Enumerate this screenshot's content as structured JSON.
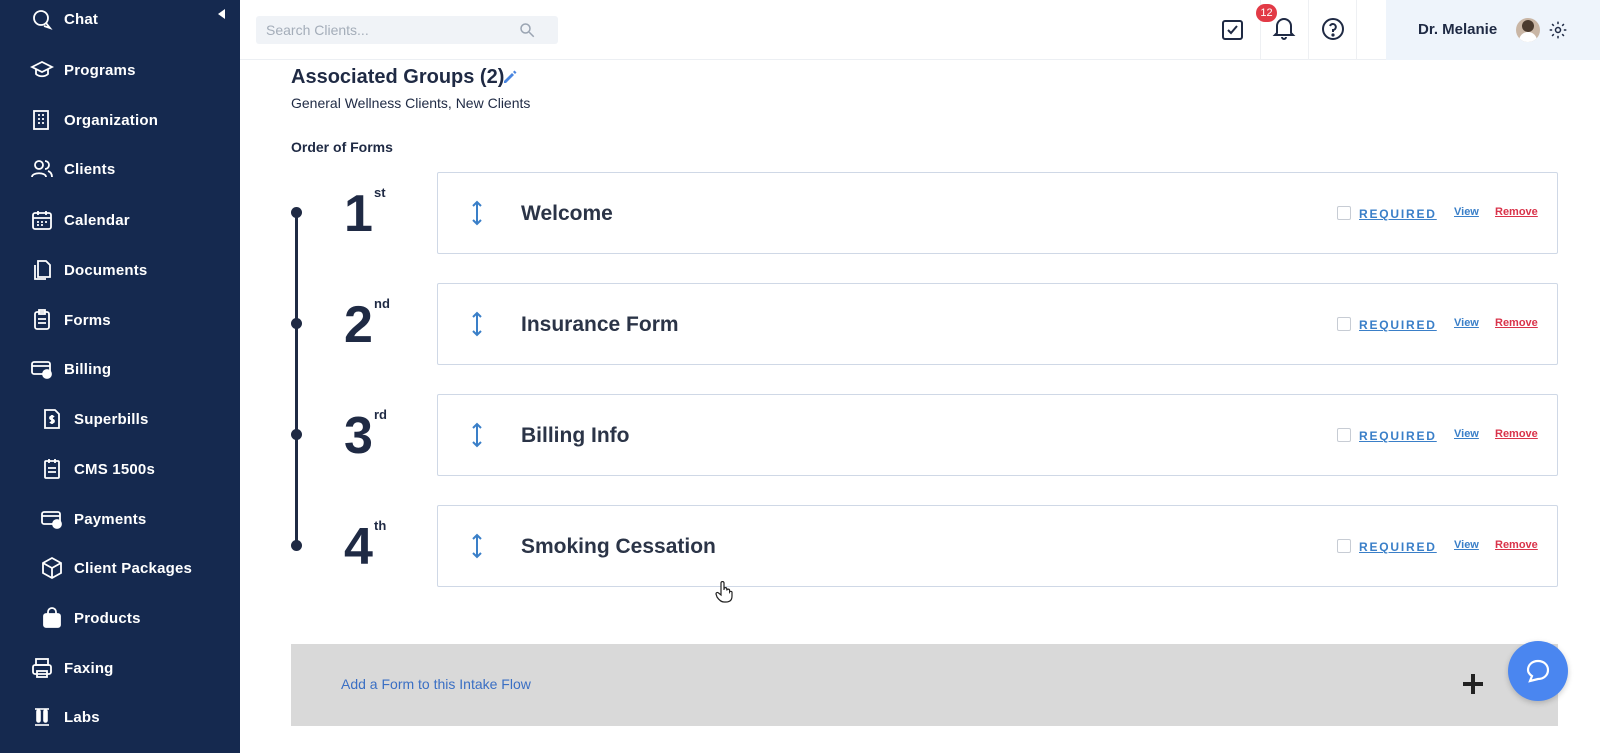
{
  "sidebar": {
    "items": [
      {
        "label": "Chat",
        "icon": "chat-icon"
      },
      {
        "label": "Programs",
        "icon": "graduation-cap-icon"
      },
      {
        "label": "Organization",
        "icon": "building-icon"
      },
      {
        "label": "Clients",
        "icon": "users-icon"
      },
      {
        "label": "Calendar",
        "icon": "calendar-icon"
      },
      {
        "label": "Documents",
        "icon": "documents-icon"
      },
      {
        "label": "Forms",
        "icon": "clipboard-icon"
      },
      {
        "label": "Billing",
        "icon": "billing-icon"
      },
      {
        "label": "Superbills",
        "icon": "superbill-icon"
      },
      {
        "label": "CMS 1500s",
        "icon": "cms-form-icon"
      },
      {
        "label": "Payments",
        "icon": "payments-icon"
      },
      {
        "label": "Client Packages",
        "icon": "package-icon"
      },
      {
        "label": "Products",
        "icon": "shopping-bag-icon"
      },
      {
        "label": "Faxing",
        "icon": "fax-icon"
      },
      {
        "label": "Labs",
        "icon": "test-tubes-icon"
      }
    ]
  },
  "topbar": {
    "search_placeholder": "Search Clients...",
    "tasks_badge": "12",
    "user_name": "Dr. Melanie"
  },
  "main": {
    "associated_groups_title": "Associated Groups (2)",
    "associated_groups_list": "General Wellness Clients, New Clients",
    "order_label": "Order of Forms",
    "steps": [
      {
        "num": "1",
        "suffix": "st",
        "form": "Welcome",
        "required_label": "REQUIRED",
        "view_label": "View",
        "remove_label": "Remove",
        "required": false
      },
      {
        "num": "2",
        "suffix": "nd",
        "form": "Insurance Form",
        "required_label": "REQUIRED",
        "view_label": "View",
        "remove_label": "Remove",
        "required": false
      },
      {
        "num": "3",
        "suffix": "rd",
        "form": "Billing Info",
        "required_label": "REQUIRED",
        "view_label": "View",
        "remove_label": "Remove",
        "required": false
      },
      {
        "num": "4",
        "suffix": "th",
        "form": "Smoking Cessation",
        "required_label": "REQUIRED",
        "view_label": "View",
        "remove_label": "Remove",
        "required": false
      }
    ],
    "add_form_label": "Add a Form to this Intake Flow"
  },
  "colors": {
    "sidebar_bg": "#15294f",
    "link_blue": "#3a7fc8",
    "remove_red": "#d9334a",
    "badge_red": "#e23a46",
    "fab_blue": "#4a86f0"
  }
}
